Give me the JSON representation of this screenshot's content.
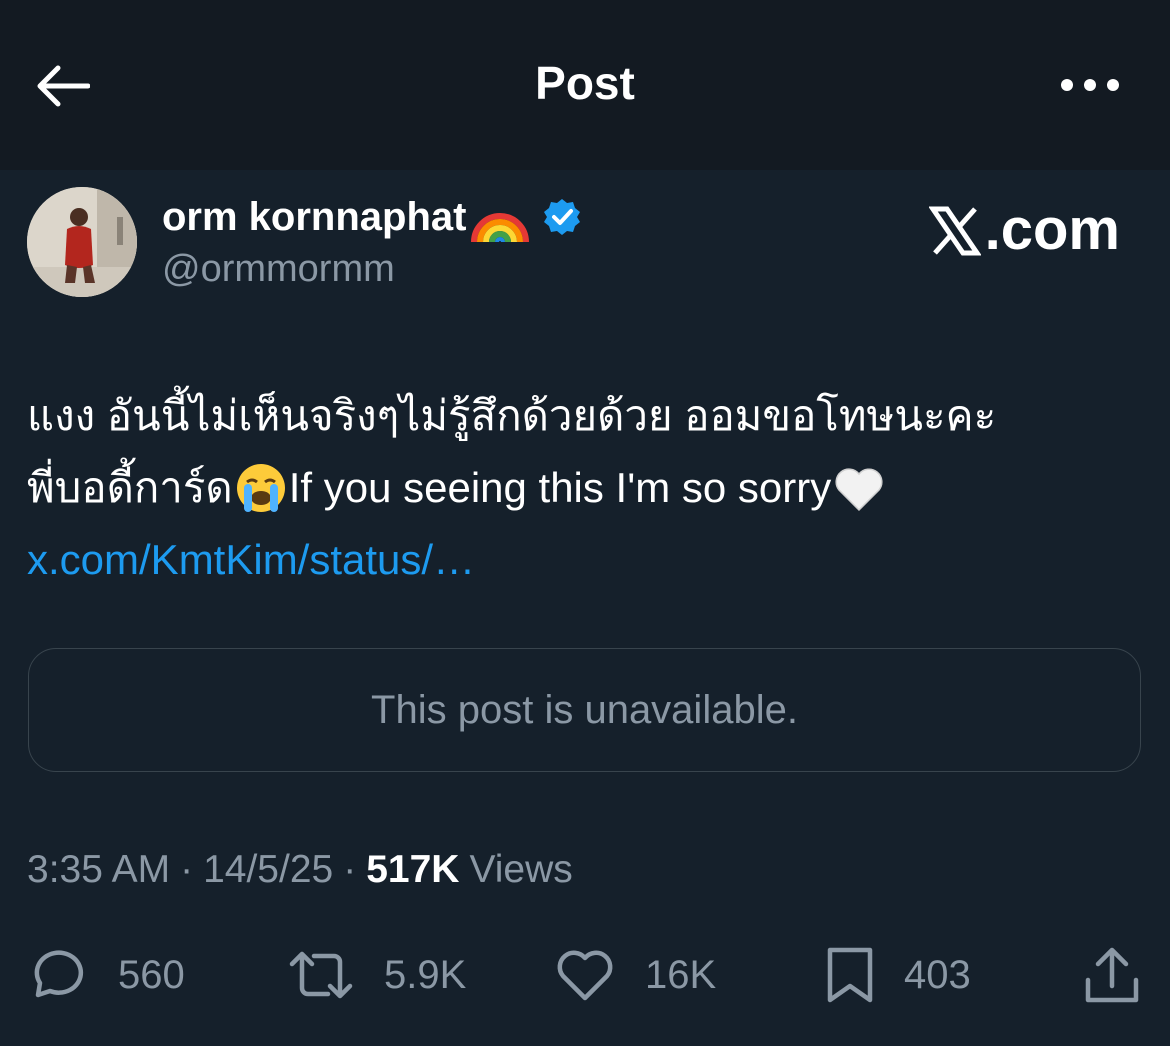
{
  "header": {
    "title": "Post",
    "back_icon": "arrow-left-icon",
    "more_icon": "more-horizontal-icon"
  },
  "author": {
    "display_name": "orm kornnaphat",
    "handle": "@ormmormm",
    "badges": [
      "rainbow-emoji-icon",
      "verified-badge-icon"
    ],
    "verified_color": "#1d9bf0"
  },
  "watermark": {
    "text": ".com",
    "logo_icon": "x-logo-icon"
  },
  "tweet": {
    "line1": "แงง อันนี้ไม่เห็นจริงๆไม่รู้สึกด้วยด้วย ออมขอโทษนะคะ",
    "line2_thai": "พี่บอดี้การ์ด",
    "line2_en": "If you seeing this I'm so sorry",
    "emoji_1": "loudly-crying-face-emoji",
    "emoji_2": "white-heart-emoji",
    "link": "x.com/KmtKim/status/…"
  },
  "quote": {
    "text": "This post is unavailable."
  },
  "meta": {
    "time": "3:35 AM",
    "date": "14/5/25",
    "separator": "·",
    "views_count": "517K",
    "views_label": "Views"
  },
  "actions": {
    "reply": {
      "icon": "reply-icon",
      "count": "560"
    },
    "repost": {
      "icon": "repost-icon",
      "count": "5.9K"
    },
    "like": {
      "icon": "heart-icon",
      "count": "16K"
    },
    "bookmark": {
      "icon": "bookmark-icon",
      "count": "403"
    },
    "share": {
      "icon": "share-icon"
    }
  },
  "colors": {
    "background": "#15202b",
    "header_background": "#131a22",
    "text_primary": "#ffffff",
    "text_secondary": "#8b98a5",
    "link": "#1d9bf0",
    "border": "#38444d"
  }
}
